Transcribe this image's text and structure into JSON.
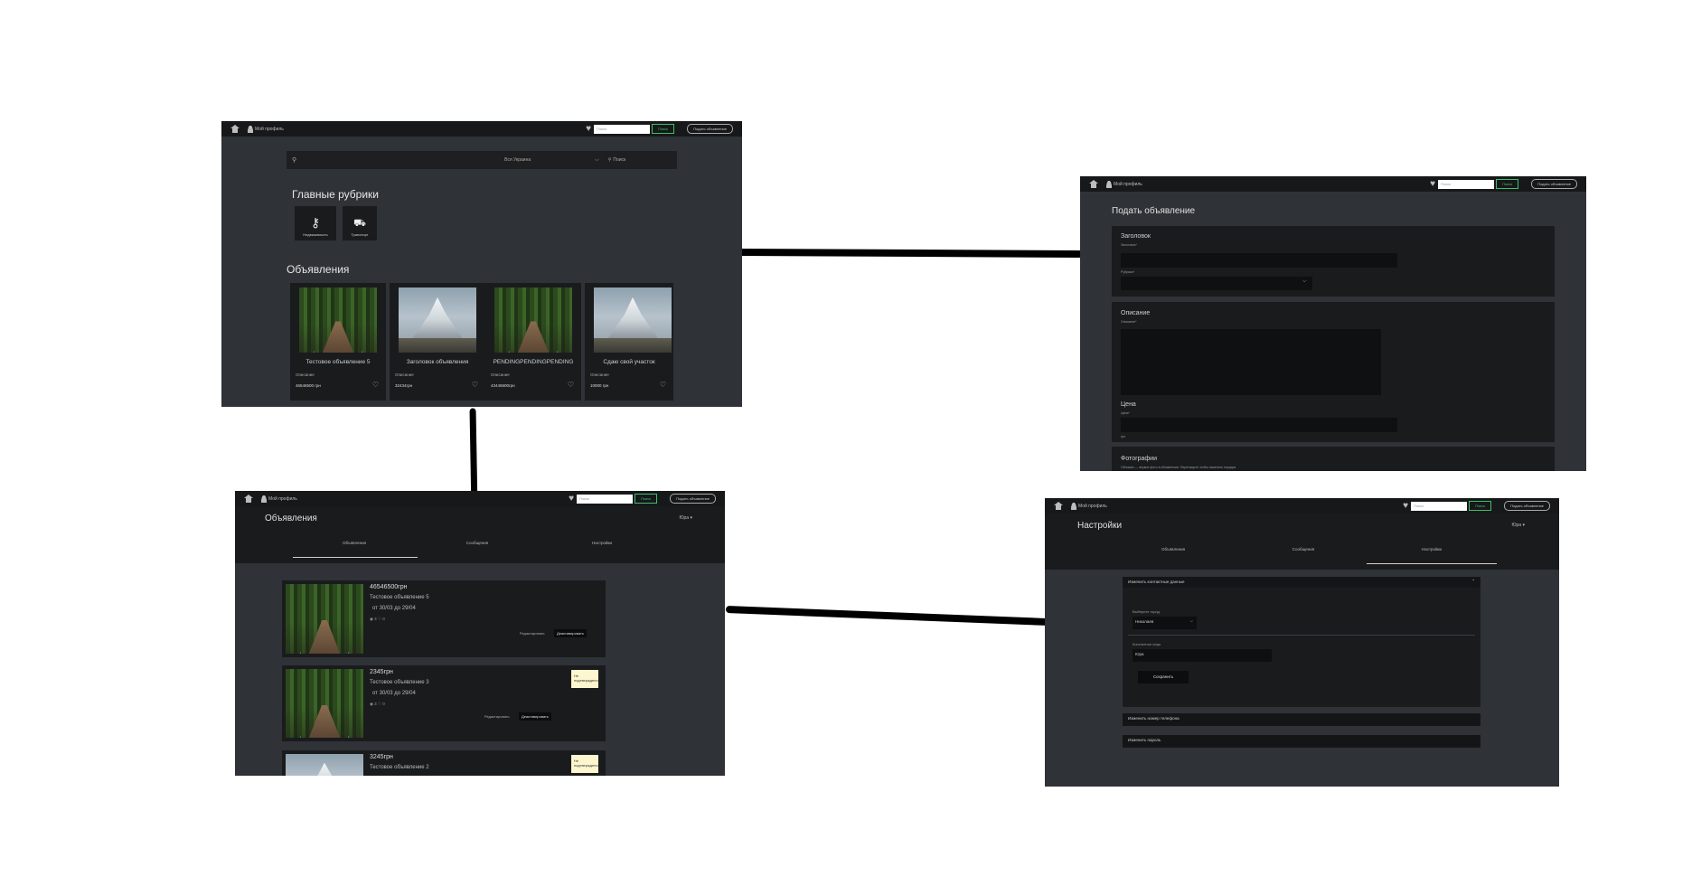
{
  "common_nav": {
    "account_label": "Мой профиль",
    "search_placeholder": "Поиск",
    "search_button": "Поиск",
    "post_button": "Подать объявление"
  },
  "home": {
    "search_region": "Вся Украина",
    "search_button": "Поиск",
    "rubrics_title": "Главные рубрики",
    "rubrics": [
      {
        "label": "Недвижимость",
        "icon": "key-icon"
      },
      {
        "label": "Транспорт",
        "icon": "car-icon"
      }
    ],
    "ads_title": "Объявления",
    "cards": [
      {
        "title": "Тестовое объявление 5",
        "desc": "Описание",
        "price": "46546500 грн",
        "image": "forest"
      },
      {
        "title": "Заголовок объявления",
        "desc": "Описание",
        "price": "32434грн",
        "image": "mountain"
      },
      {
        "title": "PENDINGPENDINGPENDING",
        "desc": "Описание",
        "price": "43446500грн",
        "image": "forest"
      },
      {
        "title": "Сдаю свой участок",
        "desc": "Описание",
        "price": "10000 грн",
        "image": "mountain"
      }
    ]
  },
  "post_form": {
    "title": "Подать объявление",
    "heading_label": "Заголовок",
    "heading_sub": "Заголовок*",
    "rubric_sub": "Рубрика*",
    "desc_label": "Описание",
    "desc_sub": "Описание*",
    "price_label": "Цена",
    "price_sub": "Цена*",
    "currency": "грн",
    "photos_label": "Фотографии",
    "photos_sub": "Обложка — первое фото в объявлении. Перетащите чтобы изменить порядок"
  },
  "my_ads": {
    "title": "Объявления",
    "user": "Юра",
    "tabs": [
      "Объявления",
      "Сообщения",
      "Настройки"
    ],
    "listings": [
      {
        "price": "46546500грн",
        "title": "Тестовое объявление 5",
        "dates": "от 30/03 до 29/04",
        "stats": "◉ 3 ♡ 0",
        "btn1": "Редактировать",
        "btn2": "Деактивировать",
        "badge": "",
        "image": "forest"
      },
      {
        "price": "2345грн",
        "title": "Тестовое объявление 3",
        "dates": "от 30/03 до 29/04",
        "stats": "◉ 3 ♡ 0",
        "btn1": "Редактировать",
        "btn2": "Деактивировать",
        "badge": "Не подтверждено",
        "image": "forest"
      },
      {
        "price": "3245грн",
        "title": "Тестовое объявление 2",
        "dates": "",
        "stats": "",
        "btn1": "",
        "btn2": "",
        "badge": "Не подтверждено",
        "image": "mountain"
      }
    ]
  },
  "settings": {
    "title": "Настройки",
    "user": "Юра",
    "tabs": [
      "Объявления",
      "Сообщения",
      "Настройки"
    ],
    "contact_header": "Изменить контактные данные",
    "city_label": "Выберите город",
    "city_value": "Николаев",
    "name_label": "Контактное лицо",
    "name_value": "Юра",
    "save": "Сохранить",
    "phone_header": "Изменить номер телефона",
    "password_header": "Изменить пароль"
  }
}
